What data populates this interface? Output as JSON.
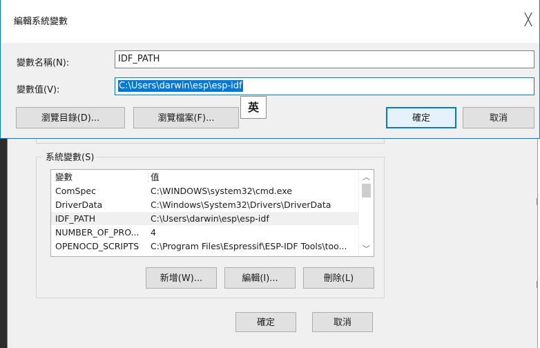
{
  "edit_dialog": {
    "title": "編輯系統變數",
    "close_glyph": "╳",
    "name_label": "變數名稱(N):",
    "name_value": "IDF_PATH",
    "value_label": "變數值(V):",
    "value_value": "C:\\Users\\darwin\\esp\\esp-idf",
    "ime_indicator": "英",
    "buttons": {
      "browse_dir": "瀏覽目錄(D)...",
      "browse_file": "瀏覽檔案(F)...",
      "ok": "確定",
      "cancel": "取消"
    }
  },
  "env_dialog": {
    "system_vars_title": "系統變數(S)",
    "columns": {
      "name": "變數",
      "value": "值"
    },
    "rows": [
      {
        "name": "ComSpec",
        "value": "C:\\WINDOWS\\system32\\cmd.exe"
      },
      {
        "name": "DriverData",
        "value": "C:\\Windows\\System32\\Drivers\\DriverData"
      },
      {
        "name": "IDF_PATH",
        "value": "C:\\Users\\darwin\\esp\\esp-idf"
      },
      {
        "name": "NUMBER_OF_PRO...",
        "value": "4"
      },
      {
        "name": "OPENOCD_SCRIPTS",
        "value": "C:\\Program Files\\Espressif\\ESP-IDF Tools\\too..."
      }
    ],
    "selected_row": 2,
    "scroll_up_glyph": "︿",
    "scroll_down_glyph": "﹀",
    "list_buttons": {
      "new": "新增(W)...",
      "edit": "編輯(I)...",
      "delete": "刪除(L)"
    },
    "dialog_buttons": {
      "ok": "確定",
      "cancel": "取消"
    }
  }
}
